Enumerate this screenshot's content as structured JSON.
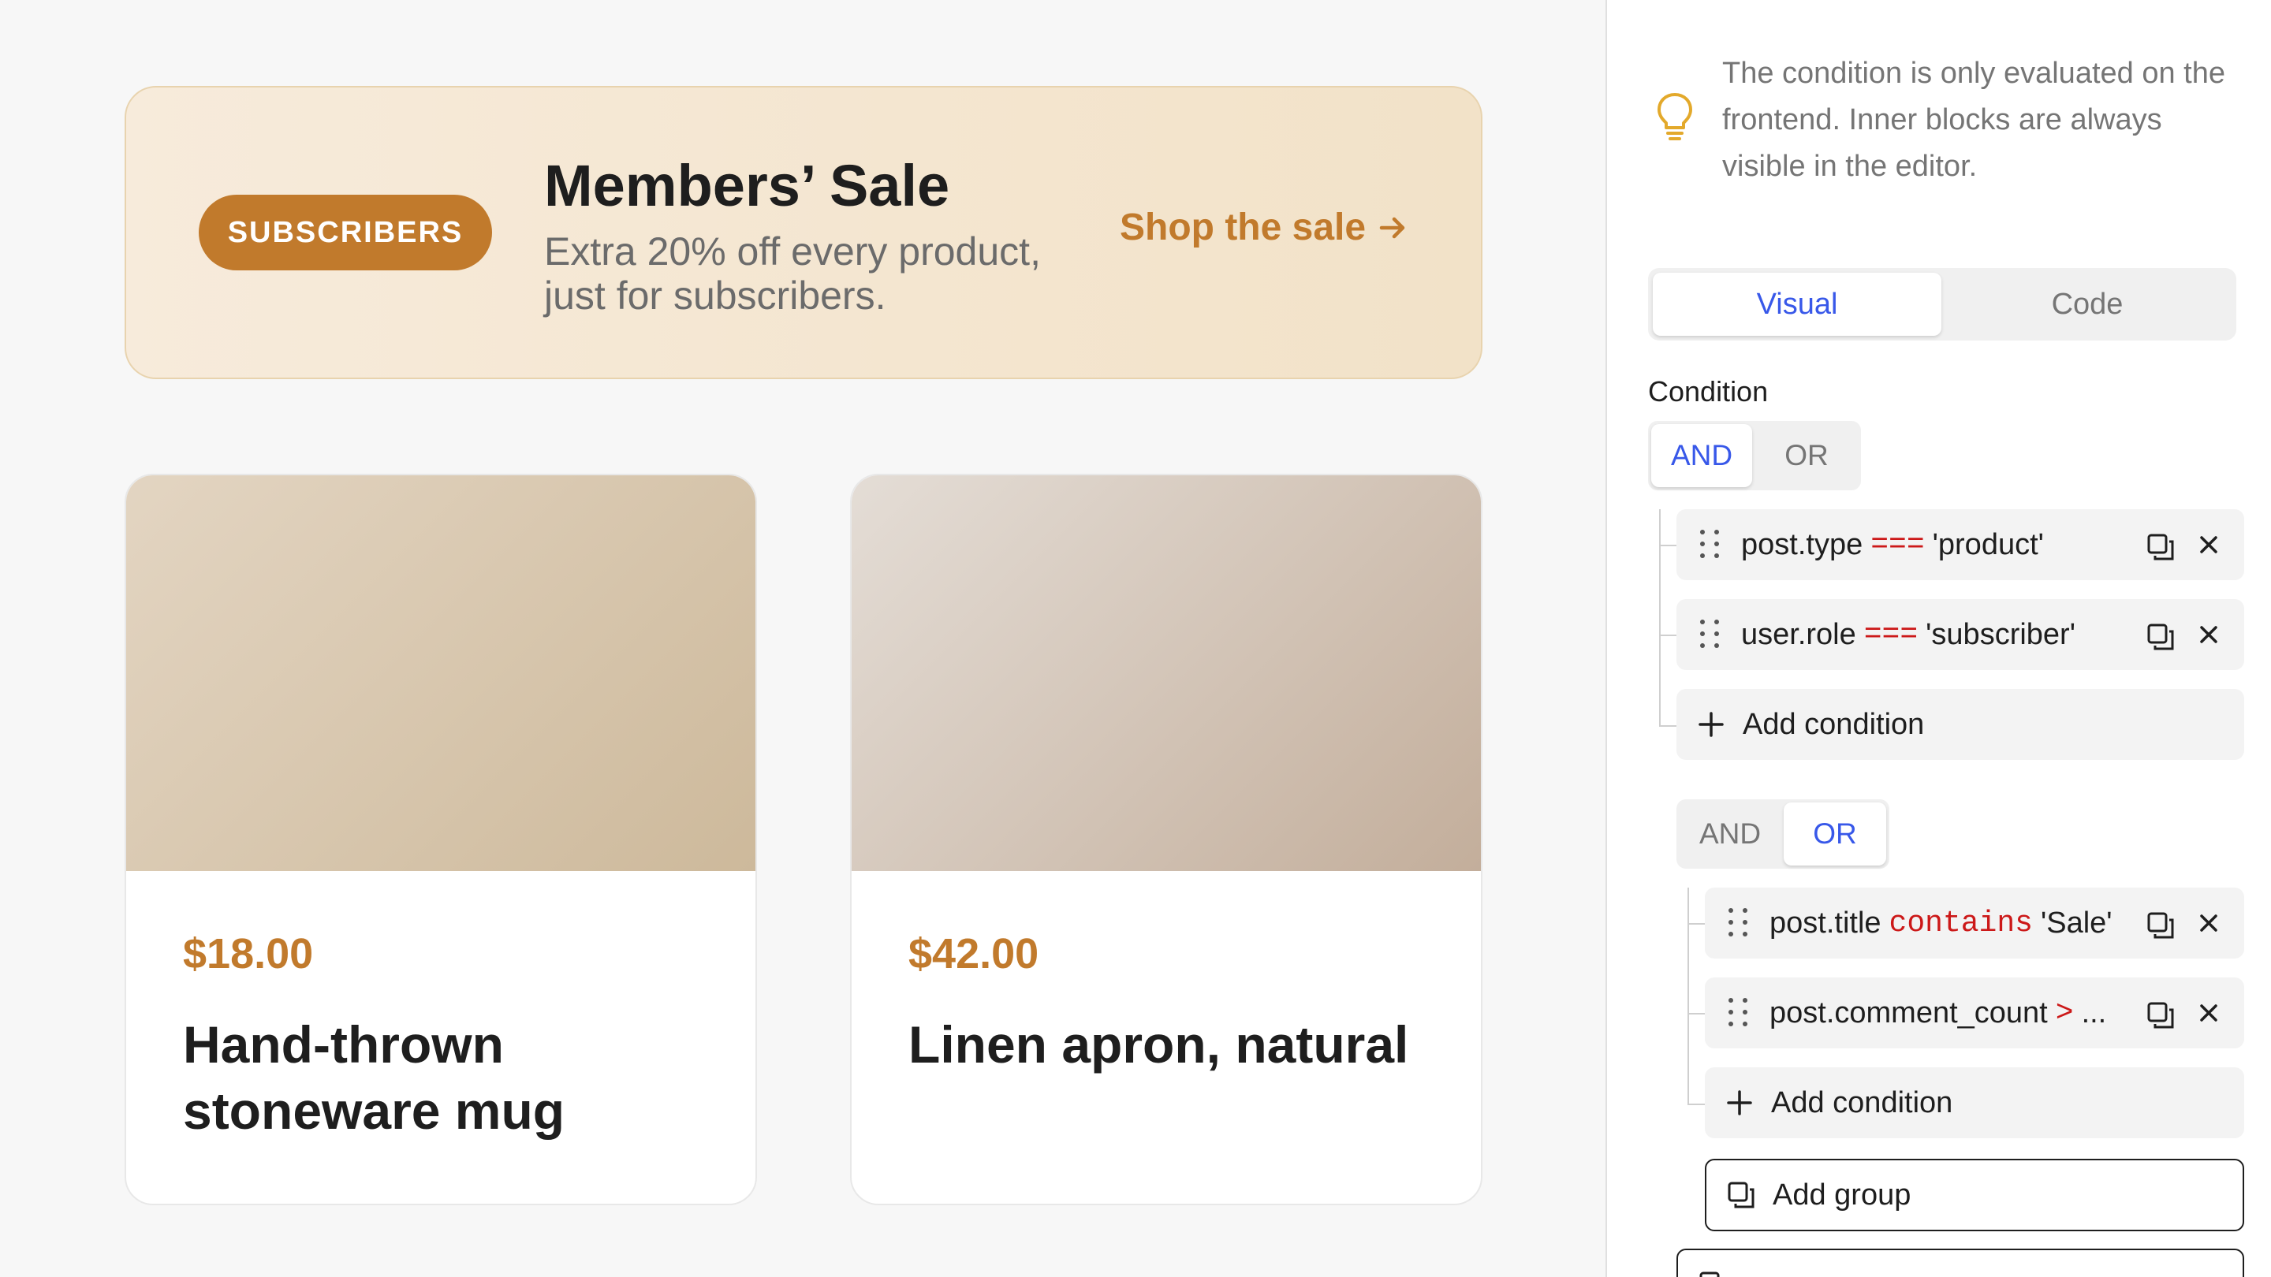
{
  "banner": {
    "badge": "SUBSCRIBERS",
    "title": "Members’ Sale",
    "subtitle": "Extra 20% off every product, just for subscribers.",
    "link": "Shop the sale",
    "link_icon": "arrow-right-icon"
  },
  "products": [
    {
      "price": "$18.00",
      "name": "Hand-thrown stoneware mug"
    },
    {
      "price": "$42.00",
      "name": "Linen apron, natural"
    }
  ],
  "sidebar": {
    "notice": "The condition is only evaluated on the frontend. Inner blocks are always visible in the editor.",
    "notice_icon": "lightbulb-icon",
    "tabs": {
      "visual": "Visual",
      "code": "Code",
      "active": "visual"
    },
    "condition_label": "Condition",
    "root_group": {
      "and_label": "AND",
      "or_label": "OR",
      "active": "AND",
      "conditions": [
        {
          "field": "post.type",
          "operator": "===",
          "value": "'product'"
        },
        {
          "field": "user.role",
          "operator": "===",
          "value": "'subscriber'"
        }
      ],
      "add_condition": "Add condition"
    },
    "nested_group": {
      "and_label": "AND",
      "or_label": "OR",
      "active": "OR",
      "conditions": [
        {
          "field": "post.title",
          "operator": "contains",
          "value": "'Sale'"
        },
        {
          "field": "post.comment_count",
          "operator": ">",
          "value": "..."
        }
      ],
      "add_condition": "Add condition",
      "add_group": "Add group"
    },
    "colors": {
      "accent": "#3858e9",
      "operator": "#cc1818",
      "brand": "#c17a2c"
    }
  }
}
